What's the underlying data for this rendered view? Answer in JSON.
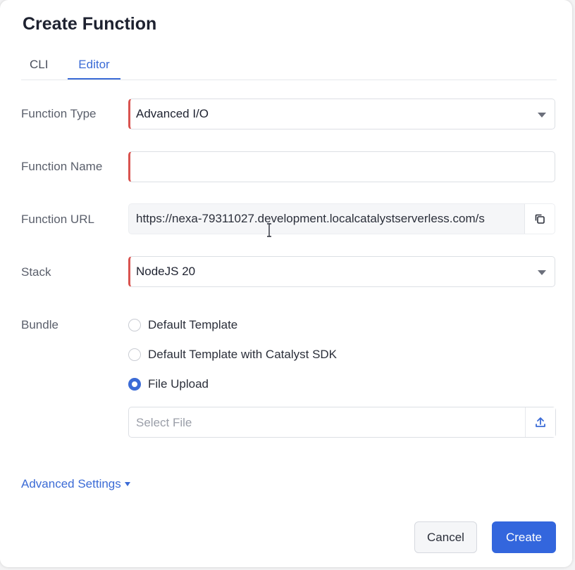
{
  "dialog": {
    "title": "Create Function"
  },
  "tabs": [
    {
      "label": "CLI",
      "active": false
    },
    {
      "label": "Editor",
      "active": true
    }
  ],
  "form": {
    "function_type": {
      "label": "Function Type",
      "value": "Advanced I/O"
    },
    "function_name": {
      "label": "Function Name",
      "value": ""
    },
    "function_url": {
      "label": "Function URL",
      "value": "https://nexa-79311027.development.localcatalystserverless.com/s"
    },
    "stack": {
      "label": "Stack",
      "value": "NodeJS 20"
    },
    "bundle": {
      "label": "Bundle",
      "options": [
        {
          "label": "Default Template",
          "checked": false
        },
        {
          "label": "Default Template with Catalyst SDK",
          "checked": false
        },
        {
          "label": "File Upload",
          "checked": true
        }
      ],
      "file_placeholder": "Select File"
    }
  },
  "advanced_settings_label": "Advanced Settings",
  "buttons": {
    "cancel": "Cancel",
    "create": "Create"
  },
  "colors": {
    "accent": "#3366dd",
    "required": "#d9534f"
  },
  "icons": {
    "copy": "copy-icon",
    "upload": "upload-icon",
    "dropdown": "caret-down-icon"
  }
}
